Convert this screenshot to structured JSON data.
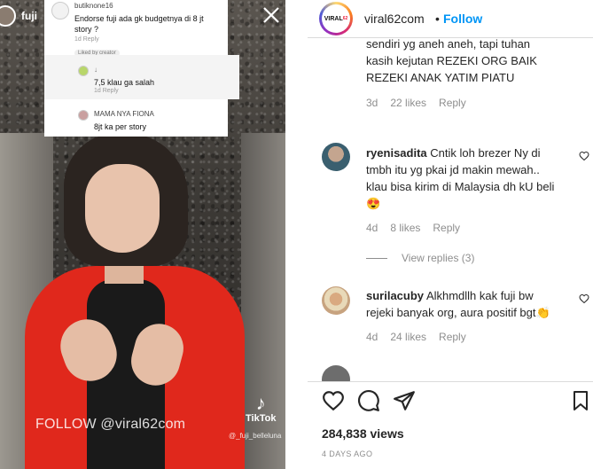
{
  "story": {
    "username": "fuji",
    "close_icon": "close-icon",
    "follow_overlay": "FOLLOW @viral62com",
    "tiktok_label": "TikTok",
    "tiktok_handle": "@_fuji_belleluna"
  },
  "overlay_comment": {
    "user": "butiknone16",
    "text_line1": "Endorse fuji ada gk budgetnya di 8 jt",
    "text_line2": "story ?",
    "meta": "1d  Reply",
    "liked": "Liked by creator",
    "reply1_text": "7,5 klau ga salah",
    "reply1_meta": "1d  Reply",
    "reply2_user": "MAMA NYA FIONA",
    "reply2_text": "8jt ka per story"
  },
  "header": {
    "avatar_label": "VIRAL",
    "avatar_sup": "62",
    "username": "viral62com",
    "dot": "•",
    "follow": "Follow"
  },
  "comments": {
    "c0": {
      "line0": "sendiri yg aneh aneh, tapi tuhan",
      "line1": "kasih kejutan REZEKI ORG BAIK",
      "line2": "REZEKI ANAK YATIM PIATU",
      "age": "3d",
      "likes": "22 likes",
      "reply": "Reply"
    },
    "c1": {
      "user": "ryenisadita",
      "line0": "Cntik loh brezer Ny di",
      "line1": "tmbh itu yg pkai jd makin mewah..",
      "line2": "klau bisa kirim di Malaysia dh kU beli",
      "emoji": "😍",
      "age": "4d",
      "likes": "8 likes",
      "reply": "Reply",
      "view_replies": "View replies (3)"
    },
    "c2": {
      "user": "surilacuby",
      "line0": "Alkhmdllh kak fuji bw",
      "line1": "rejeki banyak org, aura positif bgt",
      "emoji": "👏",
      "age": "4d",
      "likes": "24 likes",
      "reply": "Reply"
    }
  },
  "actions": {
    "views": "284,838 views",
    "ago": "4 DAYS AGO"
  }
}
